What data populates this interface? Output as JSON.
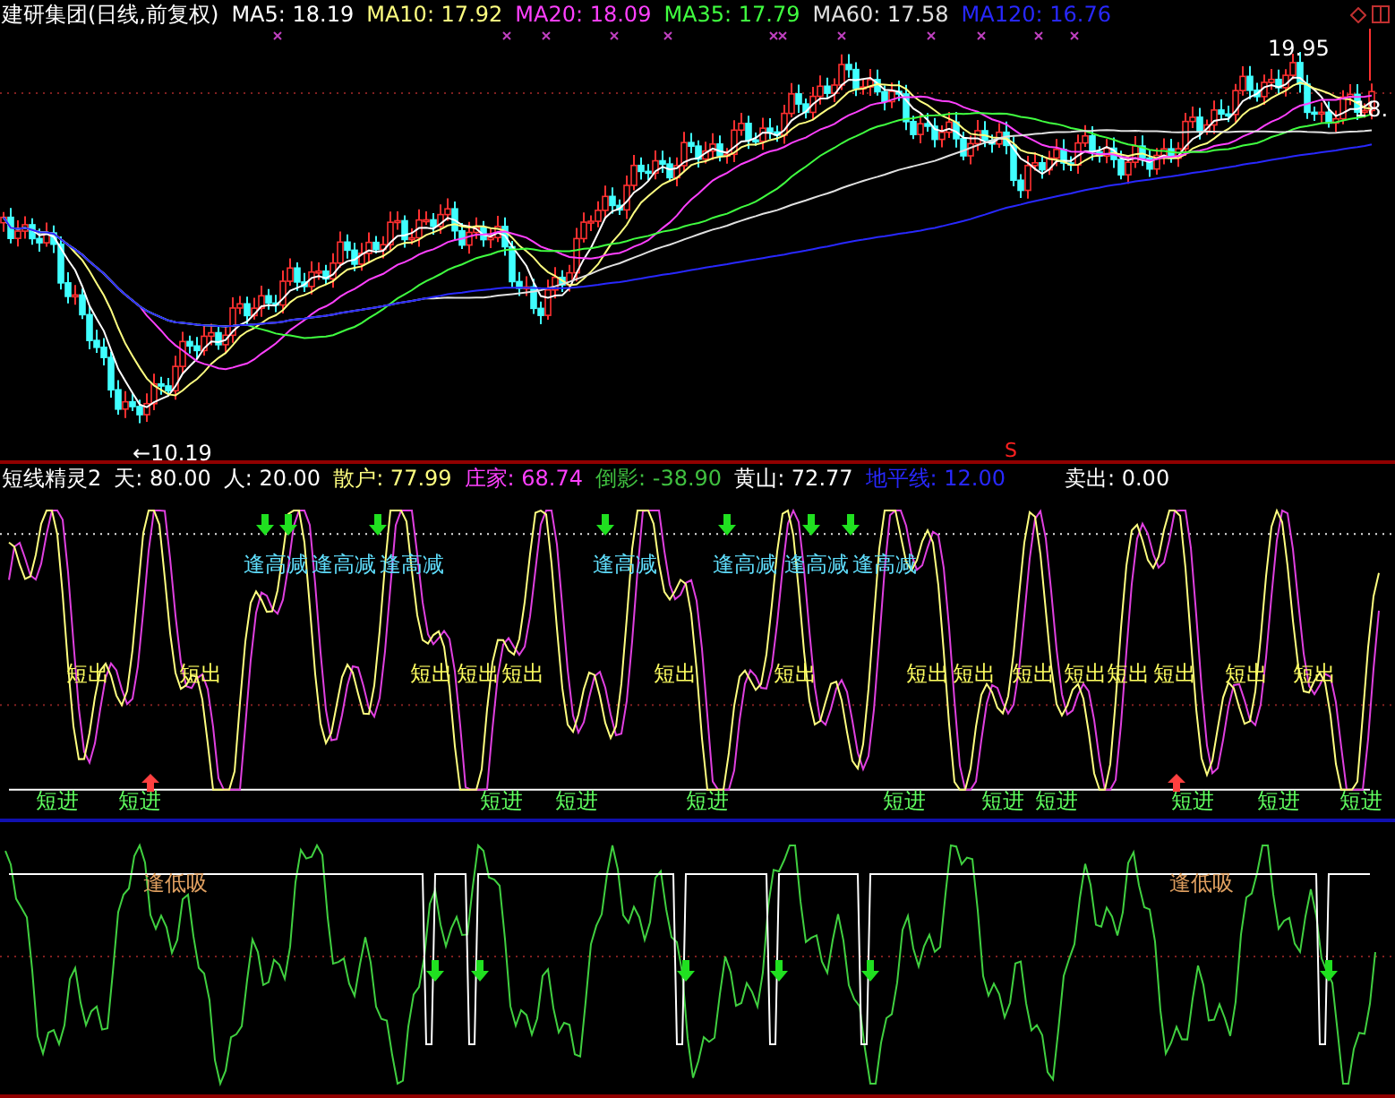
{
  "price_panel": {
    "title": "建研集团(日线,前复权)",
    "indicators": [
      {
        "label": "MA5: 18.19",
        "color": "#ffffff"
      },
      {
        "label": "MA10: 17.92",
        "color": "#ffff80"
      },
      {
        "label": "MA20: 18.09",
        "color": "#ff40ff"
      },
      {
        "label": "MA35: 17.79",
        "color": "#40ff40"
      },
      {
        "label": "MA60: 17.58",
        "color": "#e0e0e0"
      },
      {
        "label": "MA120: 16.76",
        "color": "#2828ff"
      }
    ],
    "low_mark": "←10.19",
    "high_mark": "19.95",
    "last_mark": "18.",
    "signal_mark": "S"
  },
  "oscillator_panel": {
    "title": "短线精灵2",
    "indicators": [
      {
        "label": "天: 80.00",
        "color": "#ffffff"
      },
      {
        "label": "人: 20.00",
        "color": "#ffffff"
      },
      {
        "label": "散户: 77.99",
        "color": "#ffff80"
      },
      {
        "label": "庄家: 68.74",
        "color": "#ff40ff"
      },
      {
        "label": "倒影: -38.90",
        "color": "#40c040"
      },
      {
        "label": "黄山: 72.77",
        "color": "#ffffff"
      },
      {
        "label": "地平线: 12.00",
        "color": "#2828ff"
      },
      {
        "label": "卖出: 0.00",
        "color": "#ffffff"
      }
    ],
    "sell_labels": [
      "逢高减",
      "逢高减",
      "逢高减",
      "逢高减",
      "逢高减",
      "逢高减",
      "逢高减"
    ],
    "short_out_labels": [
      "短出",
      "短出",
      "短出",
      "短出",
      "短出",
      "短出",
      "短出",
      "短出",
      "短出",
      "短出",
      "短出",
      "短出",
      "短出",
      "短出",
      "短出"
    ],
    "short_in_labels": [
      "短进",
      "短进",
      "短进",
      "短进",
      "短进",
      "短进",
      "短进",
      "短进",
      "短进",
      "短进",
      "短进"
    ]
  },
  "lower_panel": {
    "buy_labels": [
      "逢低吸",
      "逢低吸"
    ]
  }
}
